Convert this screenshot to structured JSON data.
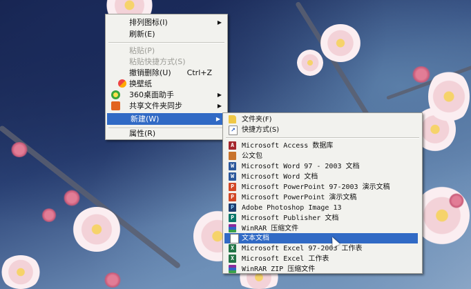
{
  "context_menu": {
    "items": [
      {
        "label": "排列图标(I)",
        "has_submenu": true
      },
      {
        "label": "刷新(E)"
      },
      {
        "label": "粘贴(P)",
        "disabled": true
      },
      {
        "label": "粘贴快捷方式(S)",
        "disabled": true
      },
      {
        "label": "撤销删除(U)",
        "shortcut": "Ctrl+Z"
      },
      {
        "label": "换壁纸",
        "icon": "wallpaper-icon"
      },
      {
        "label": "360桌面助手",
        "icon": "360-icon",
        "has_submenu": true
      },
      {
        "label": "共享文件夹同步",
        "icon": "sync-icon",
        "has_submenu": true
      },
      {
        "label": "新建(W)",
        "has_submenu": true,
        "highlighted": true
      },
      {
        "label": "属性(R)"
      }
    ],
    "arrow_glyph": "▶"
  },
  "new_submenu": {
    "items": [
      {
        "label": "文件夹(F)",
        "icon": "folder-icon"
      },
      {
        "label": "快捷方式(S)",
        "icon": "shortcut-icon"
      },
      {
        "label": "Microsoft Access 数据库",
        "icon": "access-icon"
      },
      {
        "label": "公文包",
        "icon": "briefcase-icon"
      },
      {
        "label": "Microsoft Word 97 - 2003 文档",
        "icon": "word-icon"
      },
      {
        "label": "Microsoft Word 文档",
        "icon": "word-icon"
      },
      {
        "label": "Microsoft PowerPoint 97-2003 演示文稿",
        "icon": "powerpoint-icon"
      },
      {
        "label": "Microsoft PowerPoint 演示文稿",
        "icon": "powerpoint-icon"
      },
      {
        "label": "Adobe Photoshop Image 13",
        "icon": "photoshop-icon"
      },
      {
        "label": "Microsoft Publisher 文档",
        "icon": "publisher-icon"
      },
      {
        "label": "WinRAR 压缩文件",
        "icon": "winrar-icon"
      },
      {
        "label": "文本文档",
        "icon": "text-document-icon",
        "highlighted": true
      },
      {
        "label": "Microsoft Excel 97-2003 工作表",
        "icon": "excel-icon"
      },
      {
        "label": "Microsoft Excel 工作表",
        "icon": "excel-icon"
      },
      {
        "label": "WinRAR ZIP 压缩文件",
        "icon": "winrar-zip-icon"
      }
    ]
  },
  "colors": {
    "menu_bg": "#f2f2ee",
    "highlight": "#316ac5",
    "disabled_text": "#9b9b95"
  }
}
